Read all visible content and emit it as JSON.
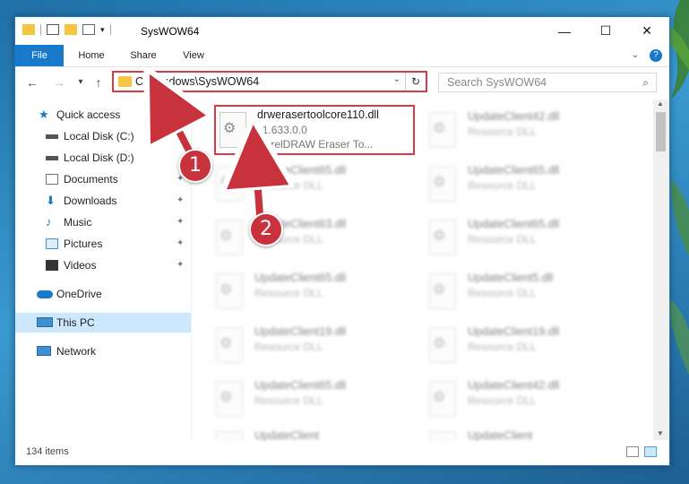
{
  "window": {
    "title": "SysWOW64",
    "controls": {
      "minimize": "—",
      "maximize": "☐",
      "close": "✕"
    }
  },
  "ribbon": {
    "tabs": [
      "File",
      "Home",
      "Share",
      "View"
    ],
    "expand_icon": "chevron-down-icon",
    "help_icon": "?"
  },
  "nav": {
    "back": "←",
    "forward": "→",
    "recent": "▾",
    "up": "↑"
  },
  "address": {
    "path": "C:\\Windows\\SysWOW64",
    "dropdown": "⌄",
    "refresh": "↻"
  },
  "search": {
    "placeholder": "Search SysWOW64",
    "icon": "⌕"
  },
  "sidebar": {
    "items": [
      {
        "label": "Quick access",
        "icon": "star-icon"
      },
      {
        "label": "Local Disk (C:)",
        "icon": "drive-icon"
      },
      {
        "label": "Local Disk (D:)",
        "icon": "drive-icon"
      },
      {
        "label": "Documents",
        "icon": "documents-icon",
        "pinned": true
      },
      {
        "label": "Downloads",
        "icon": "downloads-icon",
        "pinned": true
      },
      {
        "label": "Music",
        "icon": "music-icon",
        "pinned": true
      },
      {
        "label": "Pictures",
        "icon": "pictures-icon",
        "pinned": true
      },
      {
        "label": "Videos",
        "icon": "videos-icon",
        "pinned": true
      },
      {
        "label": "OneDrive",
        "icon": "onedrive-icon"
      },
      {
        "label": "This PC",
        "icon": "this-pc-icon",
        "selected": true
      },
      {
        "label": "Network",
        "icon": "network-icon"
      }
    ],
    "pin_glyph": "📌"
  },
  "files": {
    "highlighted": {
      "name": "drwerasertoolcore110.dll",
      "version": "11.633.0.0",
      "description": "CorelDRAW Eraser To..."
    },
    "blurred": [
      {
        "name": "UpdateClient42.dll",
        "type": "Resource DLL"
      },
      {
        "name": "UpdateClient65.dll",
        "type": "Resource DLL"
      },
      {
        "name": "UpdateClient65.dll",
        "type": "Resource DLL"
      },
      {
        "name": "UpdateClient63.dll",
        "type": "Resource DLL"
      },
      {
        "name": "UpdateClient65.dll",
        "type": "Resource DLL"
      },
      {
        "name": "UpdateClient65.dll",
        "type": "Resource DLL"
      },
      {
        "name": "UpdateClient5.dll",
        "type": "Resource DLL"
      },
      {
        "name": "UpdateClient19.dll",
        "type": "Resource DLL"
      },
      {
        "name": "UpdateClient19.dll",
        "type": "Resource DLL"
      },
      {
        "name": "UpdateClient65.dll",
        "type": "Resource DLL"
      },
      {
        "name": "UpdateClient42.dll",
        "type": "Resource DLL"
      },
      {
        "name": "UpdateClient",
        "type": ""
      },
      {
        "name": "UpdateClient",
        "type": ""
      }
    ]
  },
  "status": {
    "item_count": "134 items"
  },
  "callouts": {
    "step1": "1",
    "step2": "2"
  },
  "colors": {
    "accent": "#1979ca",
    "highlight_border": "#d63a45",
    "badge": "#c8323c",
    "selection": "#cce8ff"
  }
}
